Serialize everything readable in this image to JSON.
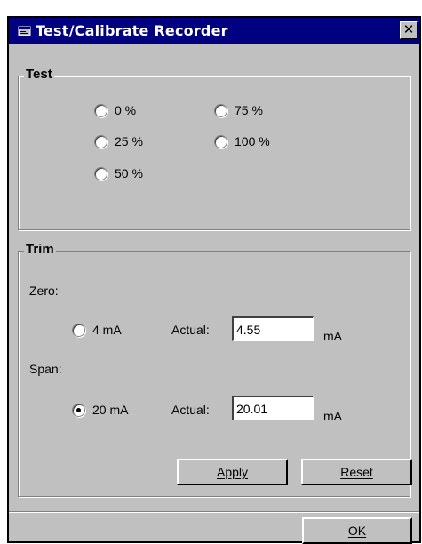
{
  "window": {
    "title": "Test/Calibrate Recorder",
    "close_glyph": "✕",
    "icon": "window-icon"
  },
  "test": {
    "legend": "Test",
    "options": [
      {
        "label": "0 %",
        "checked": false
      },
      {
        "label": "25 %",
        "checked": false
      },
      {
        "label": "50 %",
        "checked": false
      },
      {
        "label": "75 %",
        "checked": false
      },
      {
        "label": "100 %",
        "checked": false
      }
    ]
  },
  "trim": {
    "legend": "Trim",
    "zero": {
      "label": "Zero:",
      "option_label": "4 mA",
      "checked": false,
      "actual_label": "Actual:",
      "value": "4.55",
      "unit": "mA"
    },
    "span": {
      "label": "Span:",
      "option_label": "20 mA",
      "checked": true,
      "actual_label": "Actual:",
      "value": "20.01",
      "unit": "mA"
    },
    "apply_label": "Apply",
    "reset_label": "Reset"
  },
  "footer": {
    "ok_label": "OK"
  },
  "colors": {
    "titlebar": "#000080",
    "face": "#c0c0c0"
  }
}
